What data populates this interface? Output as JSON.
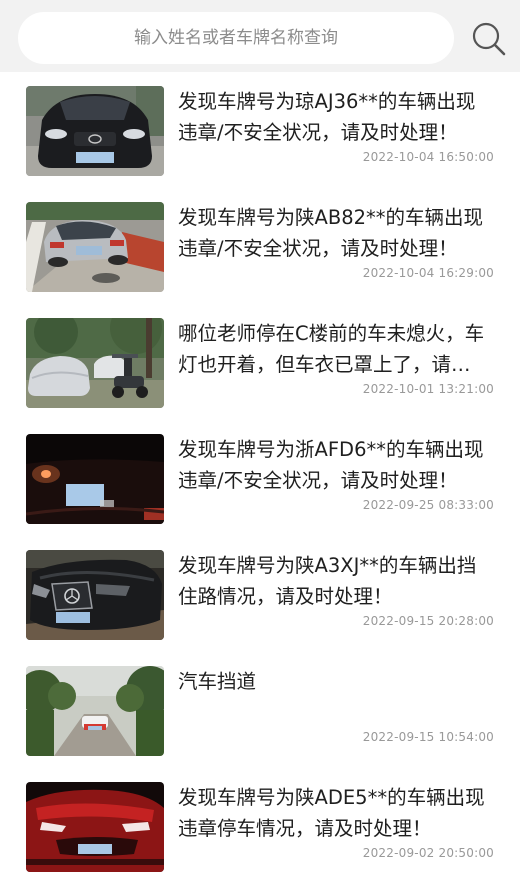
{
  "search": {
    "placeholder": "输入姓名或者车牌名称查询",
    "value": ""
  },
  "items": [
    {
      "title": "发现车牌号为琼AJ36**的车辆出现违章/不安全状况，请及时处理！",
      "time": "2022-10-04 16:50:00",
      "thumb": "black-toyota-sedan"
    },
    {
      "title": "发现车牌号为陕AB82**的车辆出现违章/不安全状况，请及时处理！",
      "time": "2022-10-04 16:29:00",
      "thumb": "silver-sedan-parked"
    },
    {
      "title": "哪位老师停在C楼前的车未熄火，车灯也开着，但车衣已罩上了，请车主尽快处理。",
      "time": "2022-10-01 13:21:00",
      "thumb": "covered-car-by-trees"
    },
    {
      "title": "发现车牌号为浙AFD6**的车辆出现违章/不安全状况，请及时处理！",
      "time": "2022-09-25 08:33:00",
      "thumb": "car-rear-at-night"
    },
    {
      "title": "发现车牌号为陕A3XJ**的车辆出挡住路情况，请及时处理！",
      "time": "2022-09-15 20:28:00",
      "thumb": "mercedes-front"
    },
    {
      "title": "汽车挡道",
      "time": "2022-09-15 10:54:00",
      "thumb": "car-on-park-road"
    },
    {
      "title": "发现车牌号为陕ADE5**的车辆出现 违章停车情况，请及时处理！",
      "time": "2022-09-02 20:50:00",
      "thumb": "red-car-front"
    }
  ]
}
